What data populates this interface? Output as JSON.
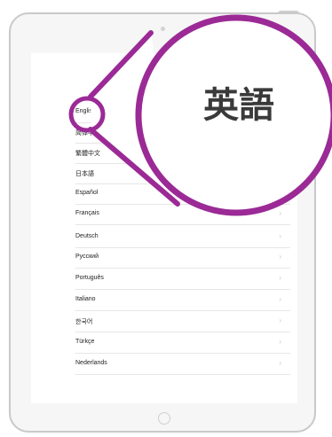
{
  "callout": {
    "text": "英語",
    "accent_color": "#9b2a96"
  },
  "languages": [
    {
      "label": "English",
      "selected": true
    },
    {
      "label": "简体中文"
    },
    {
      "label": "繁體中文"
    },
    {
      "label": "日本語"
    },
    {
      "label": "Español"
    },
    {
      "label": "Français"
    },
    {
      "label": "Deutsch"
    },
    {
      "label": "Русский"
    },
    {
      "label": "Português"
    },
    {
      "label": "Italiano"
    },
    {
      "label": "한국어"
    },
    {
      "label": "Türkçe"
    },
    {
      "label": "Nederlands"
    }
  ],
  "icons": {
    "chevron": "chevron-right-icon",
    "home": "home-button-icon"
  }
}
